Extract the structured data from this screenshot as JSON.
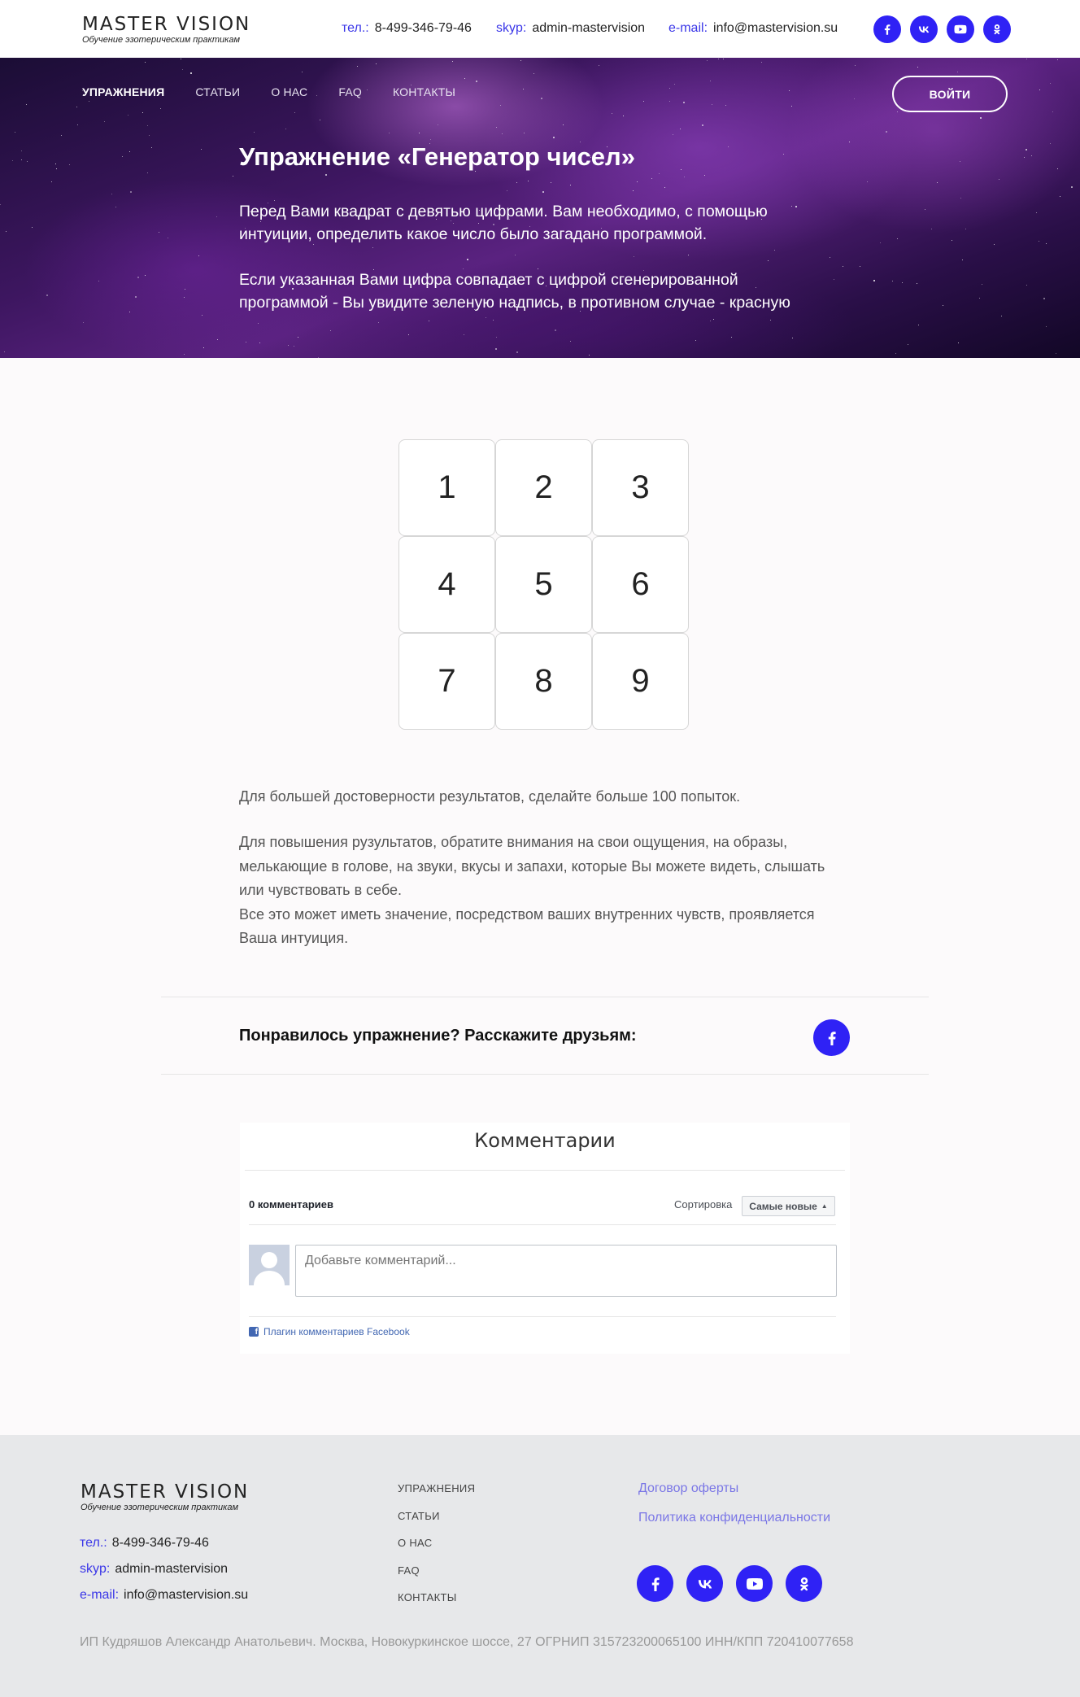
{
  "header": {
    "logo_title": "MASTER VISION",
    "logo_subtitle": "Обучение эзотерическим практикам",
    "phone_label": "тел.:",
    "phone": "8-499-346-79-46",
    "skype_label": "skyp:",
    "skype": "admin-mastervision",
    "email_label": "e-mail:",
    "email": "info@mastervision.su",
    "social": [
      "facebook-icon",
      "vk-icon",
      "youtube-icon",
      "odnoklassniki-icon"
    ]
  },
  "nav": {
    "items": [
      "УПРАЖНЕНИЯ",
      "СТАТЬИ",
      "О НАС",
      "FAQ",
      "КОНТАКТЫ"
    ],
    "login": "ВОЙТИ"
  },
  "hero": {
    "title": "Упражнение «Генератор чисел»",
    "p1_line1": "Перед Вами квадрат с девятью цифрами. Вам необходимо, с помощью",
    "p1_line2": "интуиции, определить какое число было загадано программой.",
    "p2_line1": "Если указанная Вами цифра совпадает с цифрой сгенерированной",
    "p2_line2": "программой - Вы увидите зеленую надпись, в противном случае - красную"
  },
  "grid": {
    "numbers": [
      "1",
      "2",
      "3",
      "4",
      "5",
      "6",
      "7",
      "8",
      "9"
    ]
  },
  "info": {
    "tip1": "Для большей достоверности результатов, сделайте больше 100 попыток.",
    "tip2_line1": "Для повышения рузультатов, обратите внимания на свои ощущения, на образы,",
    "tip2_line2": "мелькающие в голове, на звуки, вкусы и запахи, которые Вы можете видеть, слышать",
    "tip2_line3": "или чувствовать в себе.",
    "tip3_line1": "Все это может иметь значение, посредством ваших внутренних чувств, проявляется",
    "tip3_line2": "Ваша интуиция."
  },
  "share": {
    "text": "Понравилось упражнение? Расскажите друзьям:"
  },
  "comments": {
    "title": "Комментарии",
    "count": "0 комментариев",
    "sort_label": "Сортировка",
    "sort_value": "Самые новые",
    "placeholder": "Добавьте комментарий...",
    "plugin": "Плагин комментариев Facebook"
  },
  "footer": {
    "logo_title": "MASTER VISION",
    "logo_subtitle": "Обучение эзотерическим практикам",
    "phone_label": "тел.:",
    "phone": "8-499-346-79-46",
    "skype_label": "skyp:",
    "skype": "admin-mastervision",
    "email_label": "e-mail:",
    "email": "info@mastervision.su",
    "nav": [
      "УПРАЖНЕНИЯ",
      "СТАТЬИ",
      "О НАС",
      "FAQ",
      "КОНТАКТЫ"
    ],
    "links": [
      "Договор оферты",
      "Политика конфиденциальности"
    ],
    "copyright": "ИП Кудряшов Александр Анатольевич. Москва, Новокуркинское шоссе, 27 ОГРНИП 315723200065100 ИНН/КПП 720410077658"
  },
  "colors": {
    "accent": "#2f22f5",
    "label": "#3a36e8",
    "link": "#7a76e6"
  }
}
